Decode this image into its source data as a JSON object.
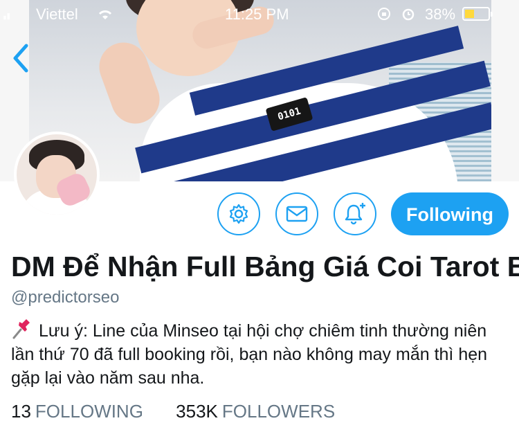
{
  "status_bar": {
    "carrier": "Viettel",
    "time": "11:25 PM",
    "battery_percent": "38%"
  },
  "profile": {
    "display_name": "DM Để Nhận Full Bảng Giá Coi Tarot B",
    "handle": "@predictorseo",
    "bio": "Lưu ý: Line của Minseo tại hội chợ chiêm tinh thường niên lần thứ 70 đã full booking rồi, bạn nào không may mắn thì hẹn gặp lại vào năm sau nha.",
    "bio_icon": "pushpin-icon",
    "banner_badge_text": "0101"
  },
  "actions": {
    "settings_icon": "gear-icon",
    "message_icon": "envelope-icon",
    "notify_icon": "bell-plus-icon",
    "following_label": "Following"
  },
  "stats": {
    "following_count": "13",
    "following_label": "FOLLOWING",
    "followers_count": "353K",
    "followers_label": "FOLLOWERS"
  },
  "colors": {
    "accent": "#1da1f2",
    "text_primary": "#14171a",
    "text_secondary": "#657786"
  }
}
